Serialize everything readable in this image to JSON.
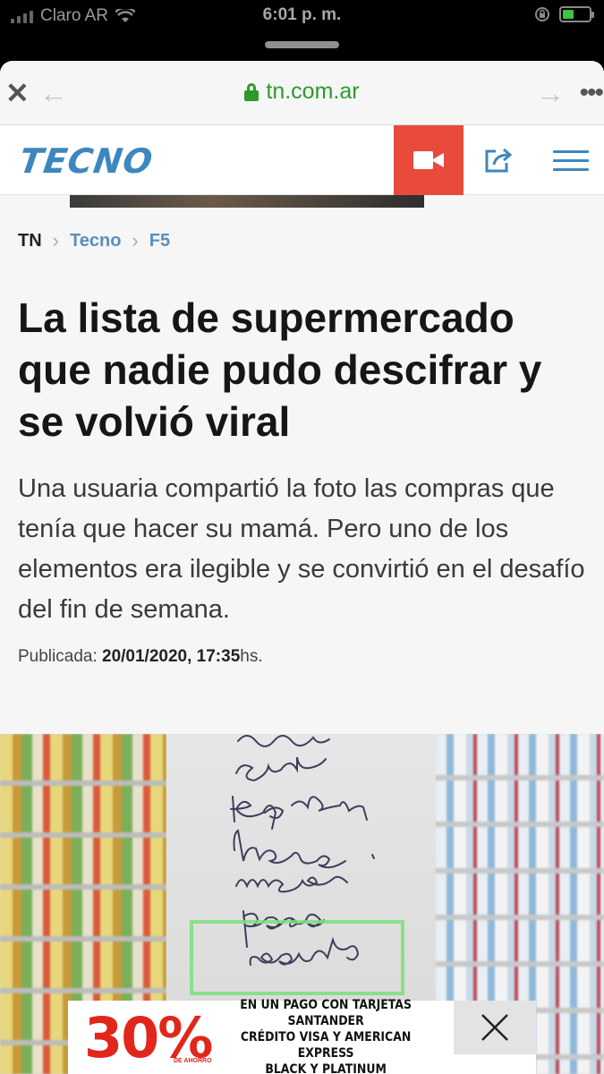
{
  "status_bar": {
    "carrier": "Claro AR",
    "time": "6:01 p. m."
  },
  "browser": {
    "url": "tn.com.ar"
  },
  "site": {
    "logo_text": "TECNO"
  },
  "breadcrumb": {
    "items": [
      "TN",
      "Tecno",
      "F5"
    ]
  },
  "article": {
    "headline": "La lista de supermercado que nadie pudo descifrar y se volvió viral",
    "subheadline": "Una usuaria compartió la foto las compras que tenía que hacer su mamá. Pero uno de los elementos era ilegible y se convirtió en el desafío del fin de semana.",
    "published_label": "Publicada:",
    "published_datetime": "20/01/2020, 17:35",
    "published_suffix": "hs."
  },
  "ad": {
    "percent": "30%",
    "small_label": "DE AHORRO",
    "line1": "EN UN PAGO CON TARJETAS SANTANDER",
    "line2": "CRÉDITO VISA Y AMERICAN EXPRESS",
    "line3": "BLACK Y PLATINUM"
  },
  "colors": {
    "accent_blue": "#3d87bf",
    "video_red": "#e84b3c",
    "secure_green": "#2c9a2c",
    "ad_red": "#e1261c"
  }
}
